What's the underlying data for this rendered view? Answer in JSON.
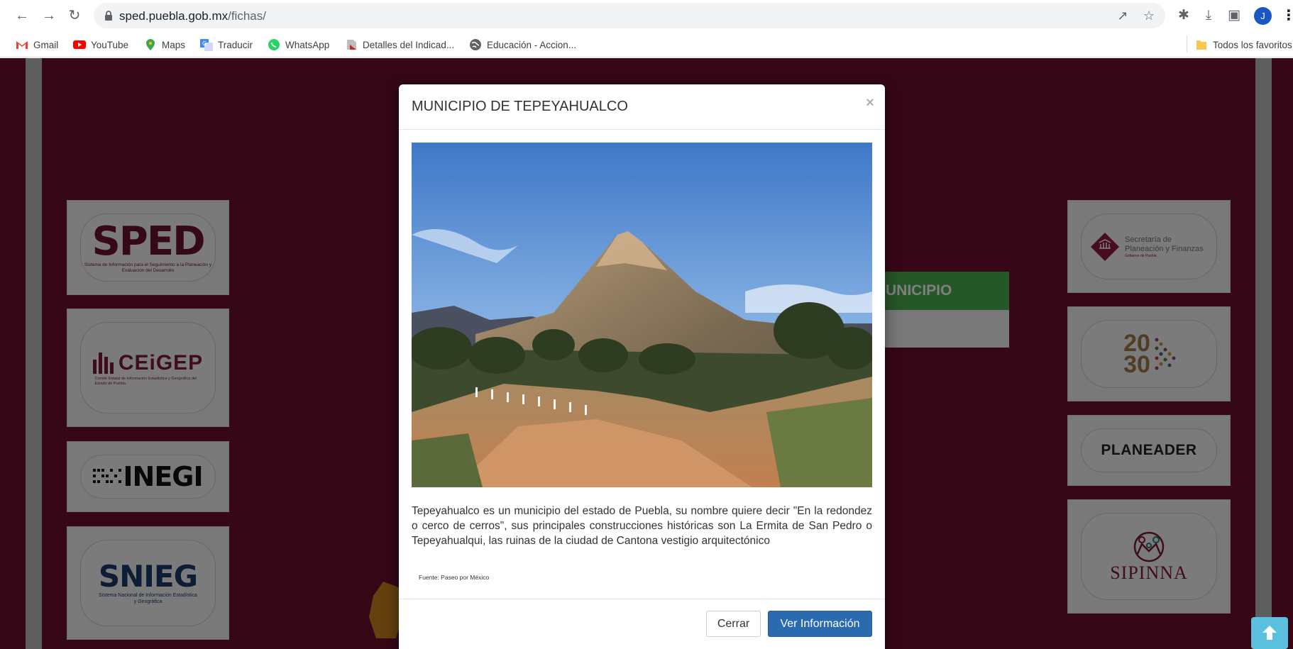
{
  "browser": {
    "url_domain": "sped.puebla.gob.mx",
    "url_path": "/fichas/",
    "bookmarks": [
      {
        "label": "Gmail",
        "icon": "gmail-icon"
      },
      {
        "label": "YouTube",
        "icon": "youtube-icon"
      },
      {
        "label": "Maps",
        "icon": "maps-icon"
      },
      {
        "label": "Traducir",
        "icon": "translate-icon"
      },
      {
        "label": "WhatsApp",
        "icon": "whatsapp-icon"
      },
      {
        "label": "Detalles del Indicad...",
        "icon": "bookmark-page-icon"
      },
      {
        "label": "Educación - Accion...",
        "icon": "globe-icon"
      }
    ],
    "all_bookmarks_label": "Todos los favoritos",
    "avatar_letter": "J"
  },
  "background": {
    "left_logos": {
      "sped": {
        "title": "SPED",
        "subtitle": "Sistema de Información para el Seguimiento a la Planeación y Evaluación del Desarrollo"
      },
      "ceigep": {
        "title": "CEiGEP",
        "subtitle": "Comité Estatal de Información Estadística y Geográfica del Estado de Puebla"
      },
      "inegi": {
        "title": "INEGI"
      },
      "snieg": {
        "title": "SNIEG",
        "subtitle": "Sistema Nacional de Información Estadística y Geográfica"
      }
    },
    "right_logos": {
      "finanzas": {
        "title": "Secretaría de Planeación y Finanzas",
        "subtitle": "Gobierno de Puebla"
      },
      "agenda": {
        "title": "2030"
      },
      "planeader": {
        "title": "PLANEADER"
      },
      "sipinna": {
        "title": "SIPINNA"
      }
    },
    "partial_button_label": "UNICIPIO",
    "colors": {
      "page_bg": "#6b0f2e",
      "green_bar": "#4caf50",
      "scroll_top": "#5bc0de"
    }
  },
  "modal": {
    "title": "MUNICIPIO DE TEPEYAHUALCO",
    "close_symbol": "×",
    "description": "Tepeyahualco es un municipio del estado de Puebla, su nombre quiere decir \"En la redondez o cerco de cerros\", sus principales construcciones históricas son La Ermita de San Pedro o Tepeyahualqui, las ruinas de la ciudad de Cantona vestigio arquitectónico",
    "source": "Fuente: Paseo por México",
    "buttons": {
      "close": "Cerrar",
      "info": "Ver Información"
    },
    "colors": {
      "primary_button": "#2a6bb0"
    }
  }
}
